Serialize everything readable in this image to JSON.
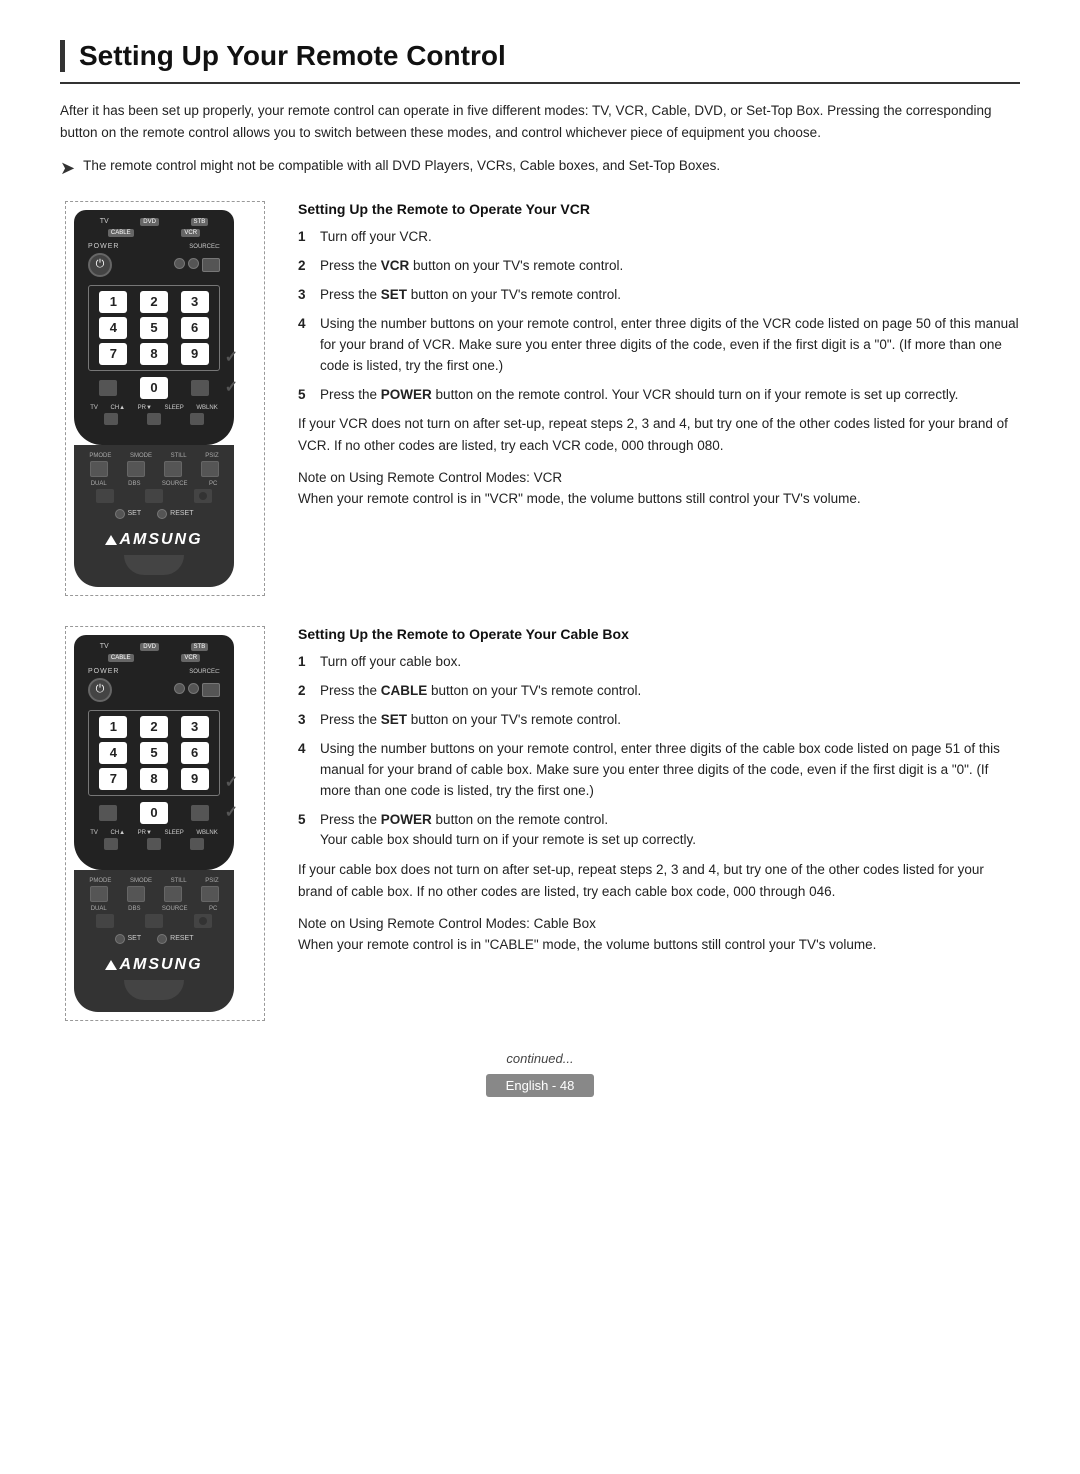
{
  "page": {
    "title": "Setting Up Your Remote Control",
    "intro": "After it has been set up properly, your remote control can operate in five different modes: TV, VCR, Cable, DVD, or Set-Top Box. Pressing the corresponding button on the remote control allows you to switch between these modes, and control whichever piece of equipment you choose.",
    "note": "The remote control might not be compatible with all DVD Players, VCRs, Cable boxes, and Set-Top Boxes.",
    "vcr_section": {
      "title": "Setting Up the Remote to Operate Your VCR",
      "steps": [
        {
          "num": "1",
          "text": "Turn off your VCR."
        },
        {
          "num": "2",
          "text": "Press the ",
          "bold": "VCR",
          "text2": " button on your TV's remote control."
        },
        {
          "num": "3",
          "text": "Press the ",
          "bold": "SET",
          "text2": " button on your TV's remote control."
        },
        {
          "num": "4",
          "text": "Using the number buttons on your remote control, enter three digits of the VCR code listed on page 50 of this manual for your brand of VCR. Make sure you enter three digits of the code, even if the first digit is a \"0\". (If more than one code is listed, try the first one.)"
        },
        {
          "num": "5",
          "text": "Press the ",
          "bold": "POWER",
          "text2": " button on the remote control. Your VCR should turn on if your remote is set up correctly."
        }
      ],
      "if_note": "If your VCR does not turn on after set-up, repeat steps 2, 3 and 4, but try one of the other codes listed for your brand of VCR. If no other codes are listed, try each VCR code, 000 through 080.",
      "mode_note_label": "Note on Using Remote Control Modes: VCR",
      "mode_note": "When your remote control is in \"VCR\" mode, the volume buttons still control your TV's volume."
    },
    "cable_section": {
      "title": "Setting Up the Remote to Operate Your Cable Box",
      "steps": [
        {
          "num": "1",
          "text": "Turn off your cable box."
        },
        {
          "num": "2",
          "text": "Press the ",
          "bold": "CABLE",
          "text2": " button on your TV's remote control."
        },
        {
          "num": "3",
          "text": "Press the ",
          "bold": "SET",
          "text2": " button on your TV's remote control."
        },
        {
          "num": "4",
          "text": "Using the number buttons on your remote control, enter three digits of the cable box code listed on page 51 of this manual for your brand of cable box. Make sure you enter three digits of the code, even if the first digit is a \"0\". (If more than one code is listed, try the first one.)"
        },
        {
          "num": "5",
          "text": "Press the ",
          "bold": "POWER",
          "text2": " button on the remote control.",
          "text3": "Your cable box should turn on if your remote is set up correctly."
        }
      ],
      "if_note": "If your cable box does not turn on after set-up, repeat steps 2, 3 and 4, but try one of the other codes listed for your brand of cable box. If no other codes are listed, try each cable box code, 000 through 046.",
      "mode_note_label": "Note on Using Remote Control Modes: Cable Box",
      "mode_note": "When your remote control is in \"CABLE\" mode, the volume buttons still control your TV's volume."
    },
    "continued": "continued...",
    "page_label": "English - 48"
  }
}
